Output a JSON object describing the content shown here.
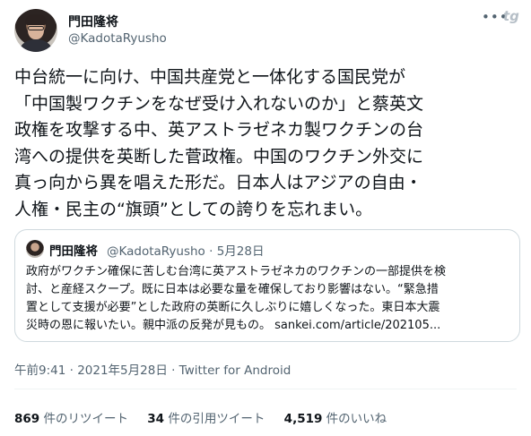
{
  "author": {
    "display_name": "門田隆将",
    "handle": "@KadotaRyusho"
  },
  "header_icons": {
    "more": "•••",
    "brand_mark": "tg"
  },
  "tweet_lines": [
    "中台統一に向け、中国共産党と一体化する国民党が",
    "「中国製ワクチンをなぜ受け入れないのか」と蔡英文",
    "政権を攻撃する中、英アストラゼネカ製ワクチンの台",
    "湾への提供を英断した菅政権。中国のワクチン外交に",
    "真っ向から異を唱えた形だ。日本人はアジアの自由・",
    "人権・民主の“旗頭”としての誇りを忘れまい。"
  ],
  "quoted_tweet": {
    "display_name": "門田隆将",
    "handle_date": "@KadotaRyusho · 5月28日",
    "lines": [
      "政府がワクチン確保に苦しむ台湾に英アストラゼネカのワクチンの一部提供を検",
      "討、と産経スクープ。既に日本は必要な量を確保しており影響はない。“緊急措",
      "置として支援が必要”とした政府の英断に久しぶりに嬉しくなった。東日本大震",
      "災時の恩に報いたい。親中派の反発が見もの。 sankei.com/article/202105..."
    ]
  },
  "meta_line": "午前9:41 · 2021年5月28日 · Twitter for Android",
  "stats": [
    {
      "count": "869",
      "label": "件のリツイート"
    },
    {
      "count": "34",
      "label": "件の引用ツイート"
    },
    {
      "count": "4,519",
      "label": "件のいいね"
    }
  ],
  "colors": {
    "text": "#0f1419",
    "secondary": "#536471",
    "border": "#cfd9de"
  }
}
